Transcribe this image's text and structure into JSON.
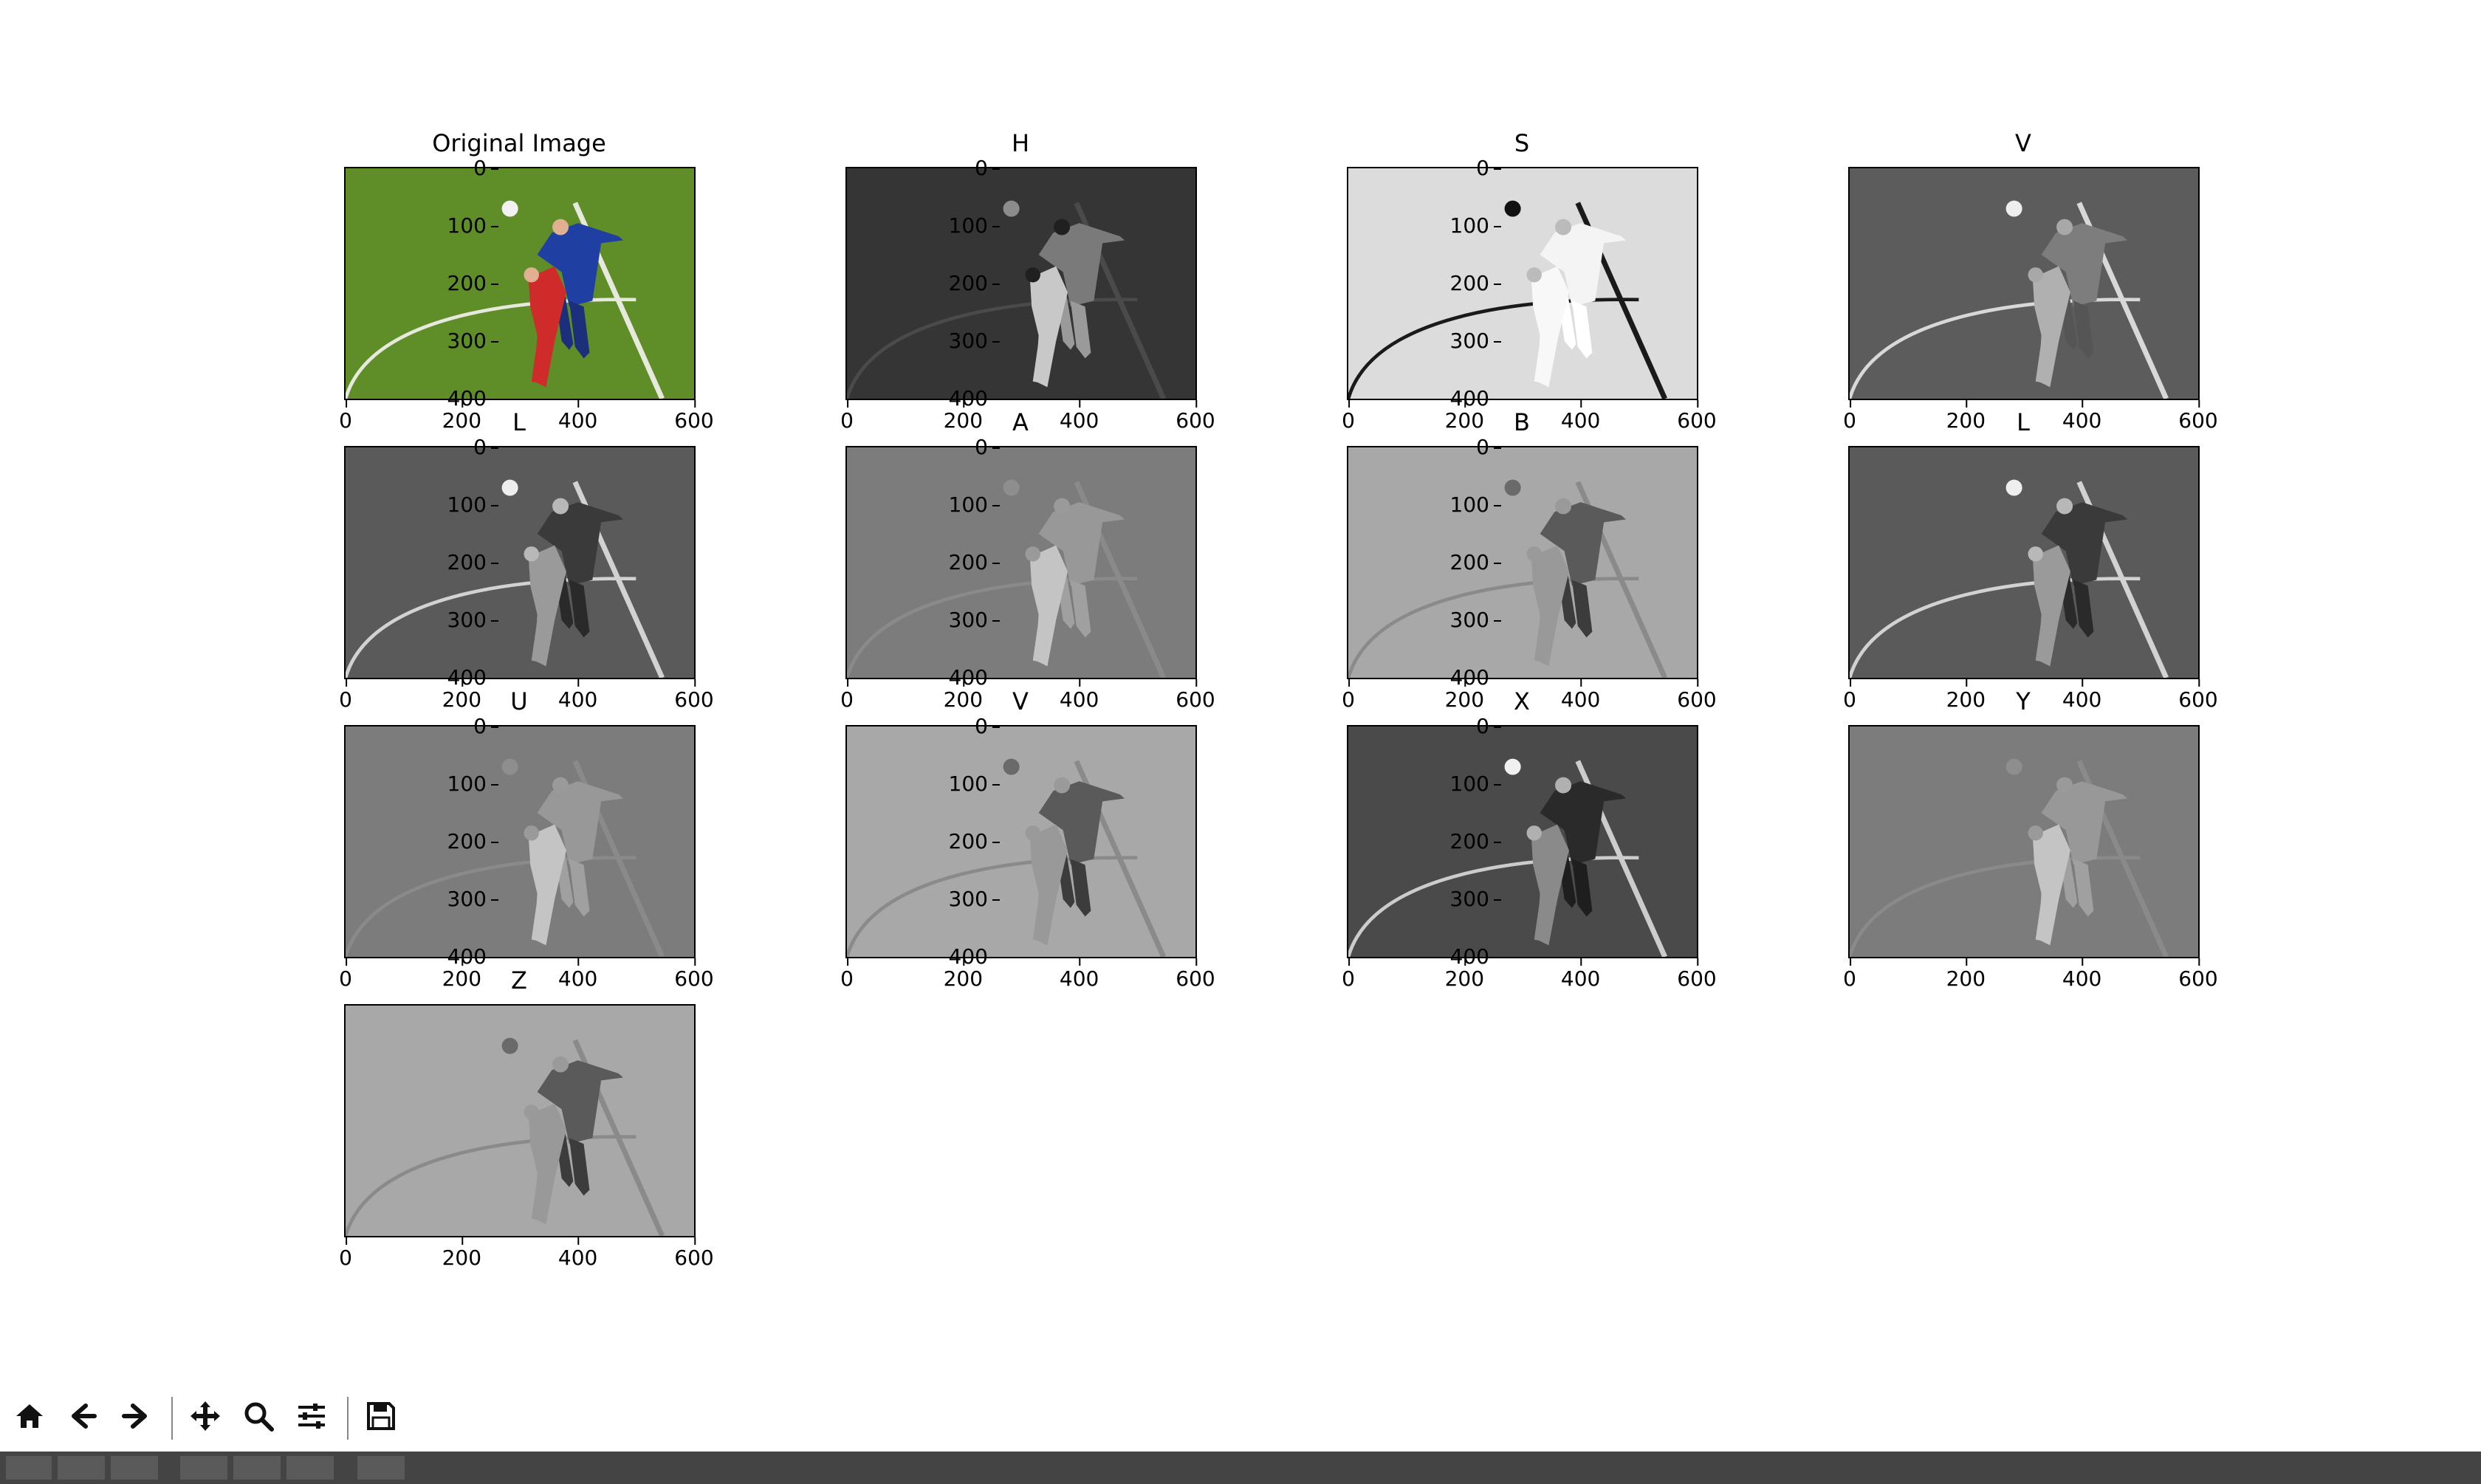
{
  "figure": {
    "panels": [
      {
        "title": "Original Image",
        "mode": "rgb"
      },
      {
        "title": "H",
        "mode": "hue"
      },
      {
        "title": "S",
        "mode": "sat"
      },
      {
        "title": "V",
        "mode": "val"
      },
      {
        "title": "L",
        "mode": "lum"
      },
      {
        "title": "A",
        "mode": "flat_mid"
      },
      {
        "title": "B",
        "mode": "flat_light"
      },
      {
        "title": "L",
        "mode": "lum"
      },
      {
        "title": "U",
        "mode": "flat_mid"
      },
      {
        "title": "V",
        "mode": "flat_light"
      },
      {
        "title": "X",
        "mode": "dark"
      },
      {
        "title": "Y",
        "mode": "flat_mid"
      },
      {
        "title": "Z",
        "mode": "flat_light"
      }
    ],
    "xticks": [
      "0",
      "200",
      "400",
      "600"
    ],
    "yticks": [
      "0",
      "100",
      "200",
      "300",
      "400"
    ]
  },
  "toolbar": {
    "buttons": [
      {
        "name": "home-button",
        "icon": "home-icon",
        "group": 0
      },
      {
        "name": "back-button",
        "icon": "arrow-left-icon",
        "group": 0
      },
      {
        "name": "forward-button",
        "icon": "arrow-right-icon",
        "group": 0
      },
      {
        "name": "pan-button",
        "icon": "move-icon",
        "group": 1
      },
      {
        "name": "zoom-button",
        "icon": "magnifier-icon",
        "group": 1
      },
      {
        "name": "configure-subplots-button",
        "icon": "sliders-icon",
        "group": 1
      },
      {
        "name": "save-button",
        "icon": "floppy-disk-icon",
        "group": 2
      }
    ]
  },
  "colors": {
    "field_green": "#5d8a24",
    "field_dark": "#2e2e2e",
    "blue_kit": "#1a3fa6",
    "red_kit": "#d02a2a"
  }
}
